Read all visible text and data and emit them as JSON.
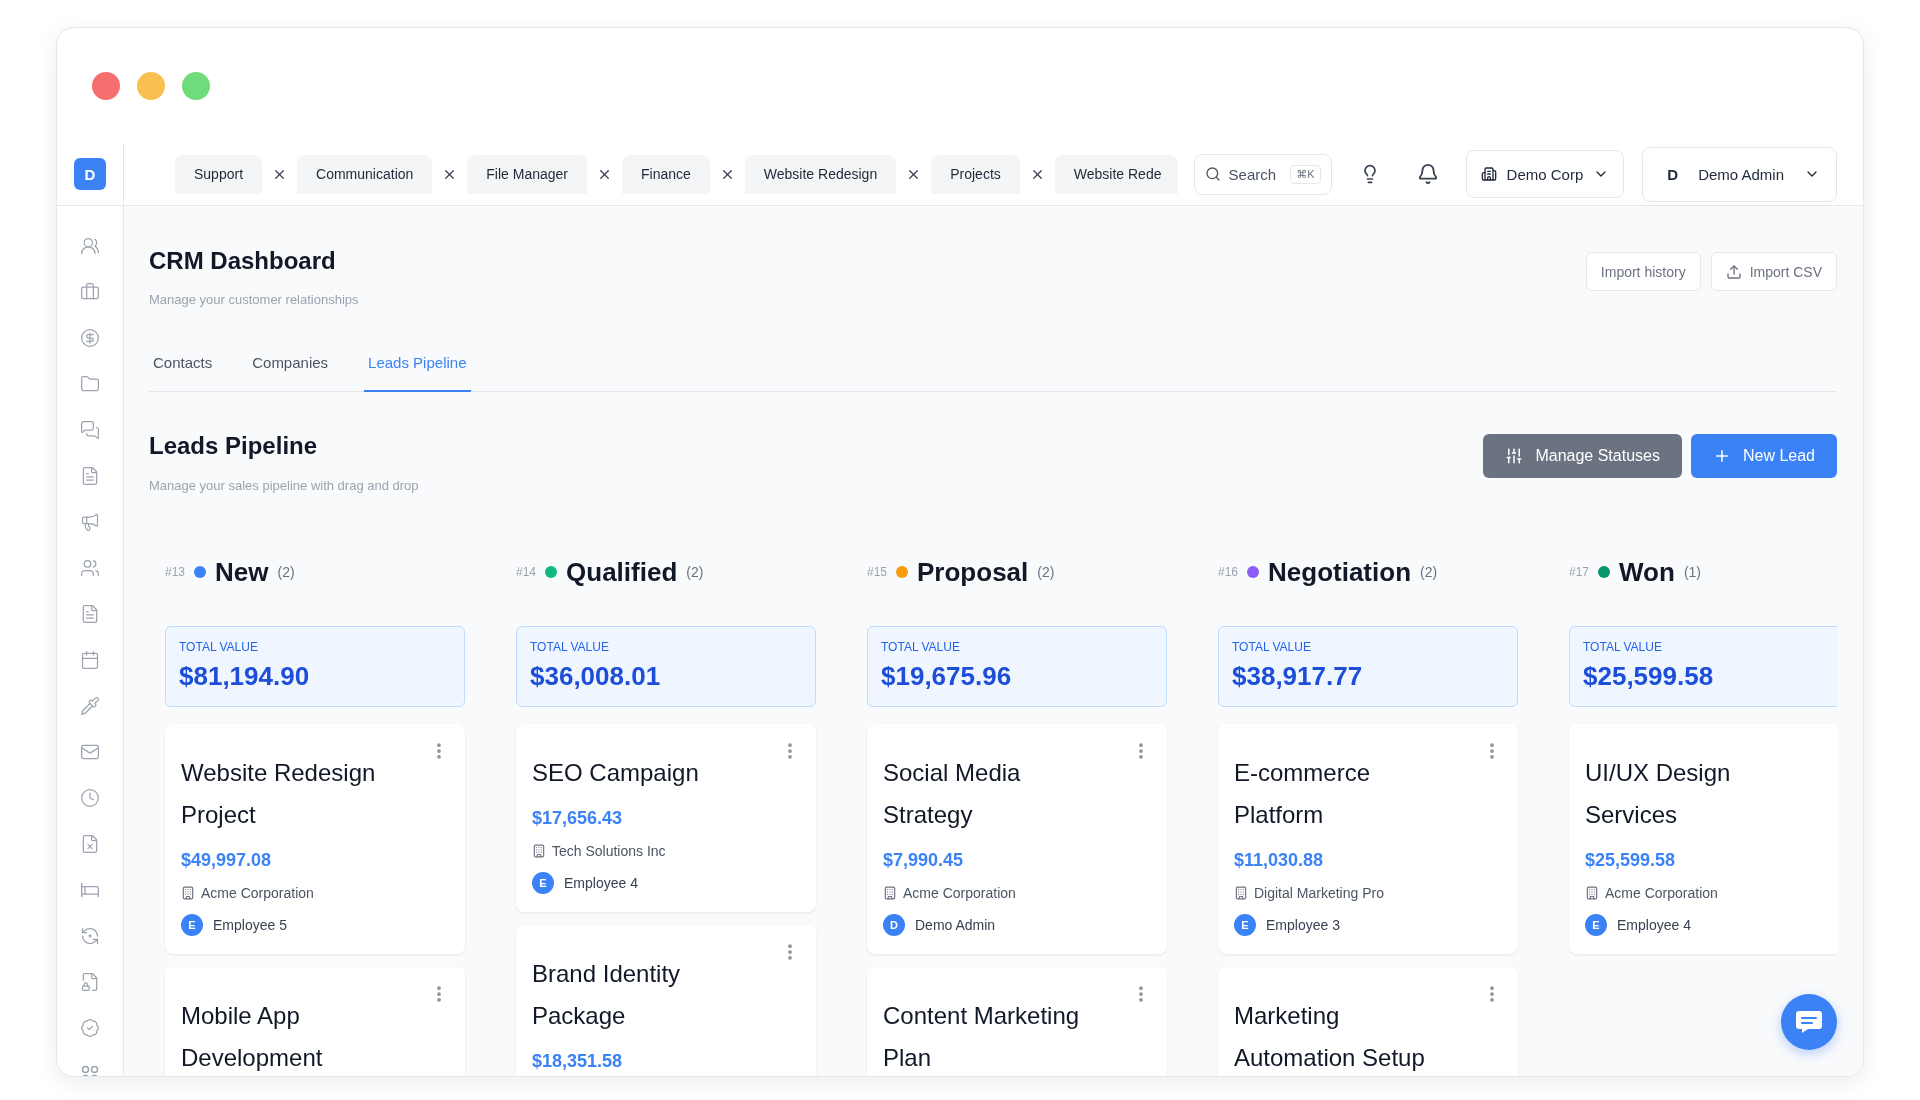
{
  "sidebar": {
    "logo": "D"
  },
  "tabs": [
    {
      "label": "Support",
      "selected": false
    },
    {
      "label": "Communication",
      "selected": false
    },
    {
      "label": "File Manager",
      "selected": false
    },
    {
      "label": "Finance",
      "selected": false
    },
    {
      "label": "Website Redesign",
      "selected": false
    },
    {
      "label": "Projects",
      "selected": false
    },
    {
      "label": "Website Rede",
      "selected": false
    }
  ],
  "search": {
    "label": "Search",
    "shortcut": "⌘K"
  },
  "company_select": {
    "value": "Demo Corp"
  },
  "user_menu": {
    "initial": "D",
    "name": "Demo Admin"
  },
  "page": {
    "title": "CRM Dashboard",
    "subtitle": "Manage your customer relationships",
    "actions": [
      {
        "label": "Import history",
        "kind": "plain"
      },
      {
        "label": "Import CSV",
        "kind": "upload"
      }
    ]
  },
  "section_tabs": [
    {
      "label": "Contacts",
      "selected": false
    },
    {
      "label": "Companies",
      "selected": false
    },
    {
      "label": "Leads Pipeline",
      "selected": true
    }
  ],
  "pipeline": {
    "title": "Leads Pipeline",
    "subtitle": "Manage your sales pipeline with drag and drop",
    "actions": [
      {
        "label": "Manage Statuses",
        "kind": "secondary"
      },
      {
        "label": "New Lead",
        "kind": "primary"
      }
    ],
    "columns": [
      {
        "number": "#13",
        "color": "#3b82f6",
        "name": "New",
        "count": "(2)",
        "total_label": "TOTAL VALUE",
        "total": "$81,194.90",
        "cards": [
          {
            "title": "Website Redesign Project",
            "amount": "$49,997.08",
            "company": "Acme Corporation",
            "assignee_initial": "E",
            "assignee": "Employee 5",
            "menu": true
          },
          {
            "title": "Mobile App Development",
            "menu": true
          }
        ]
      },
      {
        "number": "#14",
        "color": "#10b981",
        "name": "Qualified",
        "count": "(2)",
        "total_label": "TOTAL VALUE",
        "total": "$36,008.01",
        "cards": [
          {
            "title": "SEO Campaign",
            "amount": "$17,656.43",
            "company": "Tech Solutions Inc",
            "assignee_initial": "E",
            "assignee": "Employee 4",
            "menu": true
          },
          {
            "title": "Brand Identity Package",
            "amount": "$18,351.58",
            "menu": true
          }
        ]
      },
      {
        "number": "#15",
        "color": "#f59e0b",
        "name": "Proposal",
        "count": "(2)",
        "total_label": "TOTAL VALUE",
        "total": "$19,675.96",
        "cards": [
          {
            "title": "Social Media Strategy",
            "amount": "$7,990.45",
            "company": "Acme Corporation",
            "assignee_initial": "D",
            "assignee": "Demo Admin",
            "menu": true
          },
          {
            "title": "Content Marketing Plan",
            "menu": true
          }
        ]
      },
      {
        "number": "#16",
        "color": "#8b5cf6",
        "name": "Negotiation",
        "count": "(2)",
        "total_label": "TOTAL VALUE",
        "total": "$38,917.77",
        "cards": [
          {
            "title": "E-commerce Platform",
            "amount": "$11,030.88",
            "company": "Digital Marketing Pro",
            "assignee_initial": "E",
            "assignee": "Employee 3",
            "menu": true
          },
          {
            "title": "Marketing Automation Setup",
            "menu": true
          }
        ]
      },
      {
        "number": "#17",
        "color": "#059669",
        "name": "Won",
        "count": "(1)",
        "total_label": "TOTAL VALUE",
        "total": "$25,599.58",
        "cards": [
          {
            "title": "UI/UX Design Services",
            "amount": "$25,599.58",
            "company": "Acme Corporation",
            "assignee_initial": "E",
            "assignee": "Employee 4",
            "menu": false
          }
        ]
      }
    ]
  }
}
